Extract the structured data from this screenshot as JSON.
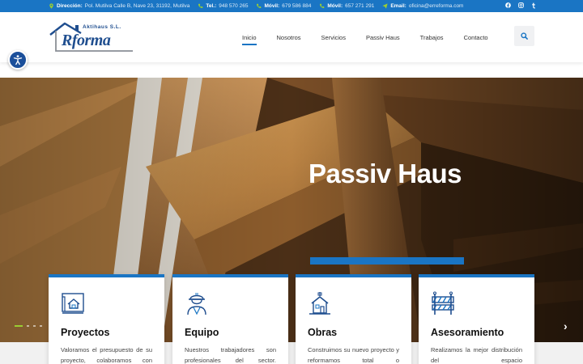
{
  "topbar": {
    "direccion_label": "Dirección:",
    "direccion_value": "Pol. Mutilva Calle B, Nave 23, 31192, Mutilva",
    "tel_label": "Tel.:",
    "tel_value": "948 570 265",
    "movil1_label": "Móvil:",
    "movil1_value": "679 586 884",
    "movil2_label": "Móvil:",
    "movil2_value": "657 271 291",
    "email_label": "Email:",
    "email_value": "oficina@erreforma.com",
    "social": [
      "facebook-icon",
      "instagram-icon",
      "tumblr-icon"
    ]
  },
  "logo": {
    "tag": "Aktihaus S.L.",
    "brand": "Rforma"
  },
  "nav": {
    "items": [
      "Inicio",
      "Nosotros",
      "Servicios",
      "Passiv Haus",
      "Trabajos",
      "Contacto"
    ],
    "active": "Inicio"
  },
  "hero": {
    "title": "Passiv Haus"
  },
  "cards": [
    {
      "icon": "blueprint-house-icon",
      "title": "Proyectos",
      "text": "Valoramos el presupuesto de su proyecto, colaboramos con"
    },
    {
      "icon": "worker-icon",
      "title": "Equipo",
      "text": "Nuestros trabajadores son profesionales del sector."
    },
    {
      "icon": "house-building-icon",
      "title": "Obras",
      "text": "Construimos su nuevo proyecto y reformamos total o"
    },
    {
      "icon": "barrier-icon",
      "title": "Asesoramiento",
      "text": "Realizamos la mejor distribución del espacio"
    }
  ],
  "colors": {
    "accent": "#1a75c4",
    "brand": "#1f4e8f",
    "slider_active": "#9acd32"
  }
}
